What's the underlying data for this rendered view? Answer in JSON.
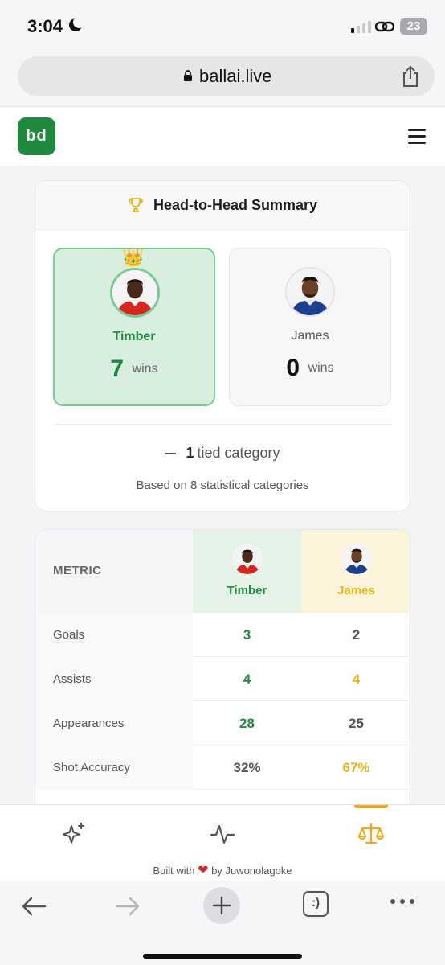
{
  "status_bar": {
    "time": "3:04",
    "battery": "23"
  },
  "browser": {
    "url": "ballai.live"
  },
  "site": {
    "logo_text": "bd"
  },
  "summary": {
    "title": "Head-to-Head Summary",
    "player1": {
      "name": "Timber",
      "wins": "7",
      "wins_label": "wins"
    },
    "player2": {
      "name": "James",
      "wins": "0",
      "wins_label": "wins"
    },
    "tied_count": "1",
    "tied_label": "tied category",
    "based_on": "Based on 8 statistical categories"
  },
  "comparison": {
    "metric_header": "METRIC",
    "player1_name": "Timber",
    "player2_name": "James",
    "rows": [
      {
        "metric": "Goals",
        "p1": "3",
        "p2": "2"
      },
      {
        "metric": "Assists",
        "p1": "4",
        "p2": "4"
      },
      {
        "metric": "Appearances",
        "p1": "28",
        "p2": "25"
      },
      {
        "metric": "Shot Accuracy",
        "p1": "32%",
        "p2": "67%"
      }
    ]
  },
  "footer": {
    "built_with": "Built with",
    "by": "by Juwonolagoke"
  },
  "icons": {
    "nav": [
      "sparkles-icon",
      "activity-icon",
      "scale-icon"
    ],
    "toolbar": [
      "back-arrow-icon",
      "forward-arrow-icon",
      "plus-icon",
      "tabs-icon",
      "more-icon"
    ]
  },
  "colors": {
    "brand_green": "#1f8a3e",
    "accent_gold": "#e8b416",
    "active_nav": "#f0a81c"
  }
}
